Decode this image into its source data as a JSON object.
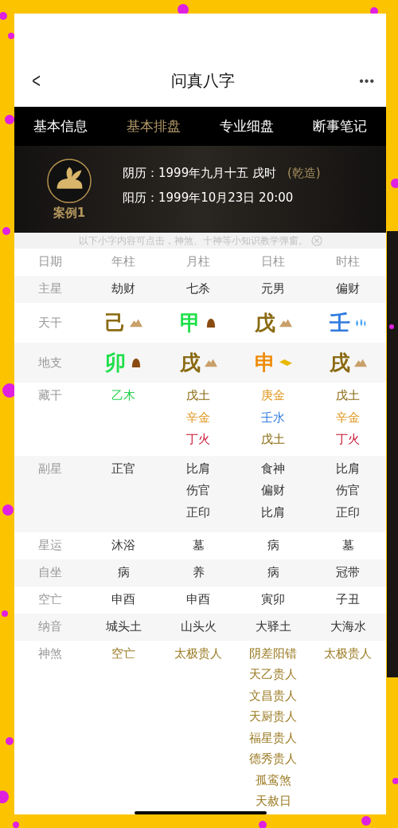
{
  "nav": {
    "back": "<",
    "title": "问真八字",
    "more": "•••"
  },
  "tabs": [
    {
      "label": "基本信息",
      "selected": false
    },
    {
      "label": "基本排盘",
      "selected": true
    },
    {
      "label": "专业细盘",
      "selected": false
    },
    {
      "label": "断事笔记",
      "selected": false
    }
  ],
  "case": {
    "name": "案例1",
    "lunar": "阴历：1999年九月十五 戌时",
    "gender": "(乾造)",
    "solar": "阳历：1999年10月23日 20:00"
  },
  "hint": "以下小字内容可点击，神煞、十神等小知识教学弹窗。",
  "table": {
    "rows": [
      {
        "kind": "header",
        "label": "日期",
        "cells": [
          [
            "年柱"
          ],
          [
            "月柱"
          ],
          [
            "日柱"
          ],
          [
            "时柱"
          ]
        ]
      },
      {
        "kind": "text",
        "label": "主星",
        "cells": [
          [
            "劫财"
          ],
          [
            "七杀"
          ],
          [
            "元男"
          ],
          [
            "偏财"
          ]
        ]
      },
      {
        "kind": "stem",
        "label": "天干",
        "cells": [
          {
            "char": "己",
            "color": "#8a6a12",
            "kind": "mountain"
          },
          {
            "char": "甲",
            "color": "#1ee04a",
            "kind": "mound"
          },
          {
            "char": "戊",
            "color": "#8a6a12",
            "kind": "mountain"
          },
          {
            "char": "壬",
            "color": "#2f7be0",
            "kind": "drops"
          }
        ]
      },
      {
        "kind": "stem",
        "label": "地支",
        "cells": [
          {
            "char": "卯",
            "color": "#1ee04a",
            "kind": "mound"
          },
          {
            "char": "戌",
            "color": "#8a6a12",
            "kind": "mountain"
          },
          {
            "char": "申",
            "color": "#f08c0c",
            "kind": "ingot"
          },
          {
            "char": "戌",
            "color": "#8a6a12",
            "kind": "mountain"
          }
        ]
      },
      {
        "kind": "colored",
        "label": "藏干",
        "cells": [
          [
            {
              "text": "乙木",
              "color": "#28d050"
            }
          ],
          [
            {
              "text": "戊土",
              "color": "#8a6a12"
            },
            {
              "text": "辛金",
              "color": "#e0961e"
            },
            {
              "text": "丁火",
              "color": "#c8102e"
            }
          ],
          [
            {
              "text": "庚金",
              "color": "#e0961e"
            },
            {
              "text": "壬水",
              "color": "#2f7be0"
            },
            {
              "text": "戊土",
              "color": "#8a6a12"
            }
          ],
          [
            {
              "text": "戊土",
              "color": "#8a6a12"
            },
            {
              "text": "辛金",
              "color": "#e0961e"
            },
            {
              "text": "丁火",
              "color": "#c8102e"
            }
          ]
        ]
      },
      {
        "kind": "text",
        "label": "副星",
        "cells": [
          [
            "正官"
          ],
          [
            "比肩",
            "伤官",
            "正印"
          ],
          [
            "食神",
            "偏财",
            "比肩"
          ],
          [
            "比肩",
            "伤官",
            "正印"
          ]
        ]
      },
      {
        "kind": "text",
        "label": "星运",
        "cells": [
          [
            "沐浴"
          ],
          [
            "墓"
          ],
          [
            "病"
          ],
          [
            "墓"
          ]
        ]
      },
      {
        "kind": "text",
        "label": "自坐",
        "cells": [
          [
            "病"
          ],
          [
            "养"
          ],
          [
            "病"
          ],
          [
            "冠带"
          ]
        ]
      },
      {
        "kind": "text",
        "label": "空亡",
        "cells": [
          [
            "申酉"
          ],
          [
            "申酉"
          ],
          [
            "寅卯"
          ],
          [
            "子丑"
          ]
        ]
      },
      {
        "kind": "text",
        "label": "纳音",
        "cells": [
          [
            "城头土"
          ],
          [
            "山头火"
          ],
          [
            "大驿土"
          ],
          [
            "大海水"
          ]
        ]
      },
      {
        "kind": "shensha",
        "label": "神煞",
        "cells": [
          [
            "空亡"
          ],
          [
            "太极贵人"
          ],
          [
            "阴差阳错",
            "天乙贵人",
            "文昌贵人",
            "天厨贵人",
            "福星贵人",
            "德秀贵人",
            "孤鸾煞",
            "天赦日"
          ],
          [
            "太极贵人"
          ]
        ]
      }
    ]
  }
}
